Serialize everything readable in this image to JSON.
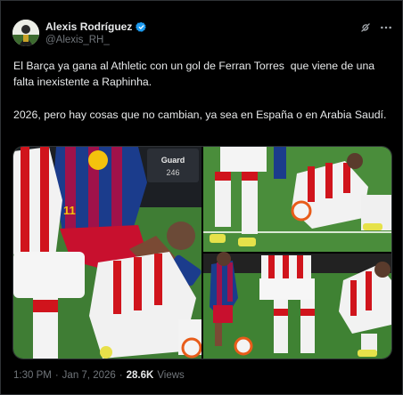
{
  "author": {
    "display_name": "Alexis Rodríguez",
    "handle": "@Alexis_RH_",
    "verified": true
  },
  "icons": {
    "verified": "verified-badge-icon",
    "grok": "grok-icon",
    "more": "more-options-icon"
  },
  "tweet": {
    "paragraph_1": "El Barça ya gana al Athletic con un gol de Ferran Torres  que viene de una falta inexistente a Raphinha.",
    "paragraph_2": "2026, pero hay cosas que no cambian, ya sea en España o en Arabia Saudí."
  },
  "media": {
    "billboard_line_1": "Guard",
    "billboard_line_2": "246",
    "jersey_number": "11"
  },
  "meta": {
    "time": "1:30 PM",
    "separator": "·",
    "date": "Jan 7, 2026",
    "views_count": "28.6K",
    "views_label": "Views"
  },
  "colors": {
    "background": "#000000",
    "text": "#e7e9ea",
    "secondary": "#71767b",
    "verified": "#1d9bf0",
    "border": "#2f3336"
  }
}
